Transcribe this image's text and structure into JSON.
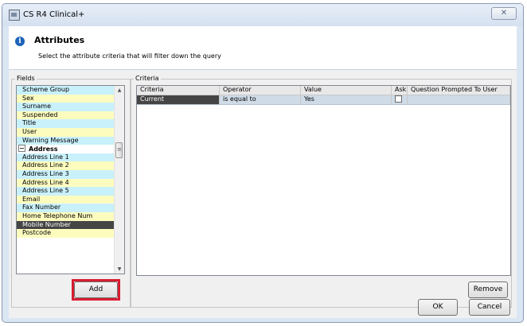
{
  "window": {
    "title": "CS R4 Clinical+",
    "close_glyph": "✕"
  },
  "header": {
    "info_glyph": "i",
    "title": "Attributes",
    "subtitle": "Select the attribute criteria that will filter down the query"
  },
  "fields": {
    "label": "Fields",
    "items": [
      {
        "label": "Scheme Group",
        "style": "cyan"
      },
      {
        "label": "Sex",
        "style": "yellow"
      },
      {
        "label": "Surname",
        "style": "cyan"
      },
      {
        "label": "Suspended",
        "style": "yellow"
      },
      {
        "label": "Title",
        "style": "cyan"
      },
      {
        "label": "User",
        "style": "yellow"
      },
      {
        "label": "Warning Message",
        "style": "cyan"
      },
      {
        "label": "Address",
        "style": "group"
      },
      {
        "label": "Address Line 1",
        "style": "cyan"
      },
      {
        "label": "Address Line 2",
        "style": "yellow"
      },
      {
        "label": "Address Line 3",
        "style": "cyan"
      },
      {
        "label": "Address Line 4",
        "style": "yellow"
      },
      {
        "label": "Address Line 5",
        "style": "cyan"
      },
      {
        "label": "Email",
        "style": "yellow"
      },
      {
        "label": "Fax Number",
        "style": "cyan"
      },
      {
        "label": "Home Telephone Num",
        "style": "yellow"
      },
      {
        "label": "Mobile Number",
        "style": "selected"
      },
      {
        "label": "Postcode",
        "style": "yellow"
      }
    ],
    "add_label": "Add"
  },
  "criteria": {
    "label": "Criteria",
    "columns": [
      "Criteria",
      "Operator",
      "Value",
      "Ask",
      "Question Prompted To User"
    ],
    "rows": [
      {
        "criteria": "Current",
        "operator": "is equal to",
        "value": "Yes",
        "ask": false,
        "question": ""
      }
    ],
    "remove_label": "Remove"
  },
  "footer": {
    "ok_label": "OK",
    "cancel_label": "Cancel"
  },
  "colors": {
    "highlight": "#d81d2f",
    "selected_row": "#454545",
    "cyan_row": "#c9f1fb",
    "yellow_row": "#fdfcbf"
  }
}
